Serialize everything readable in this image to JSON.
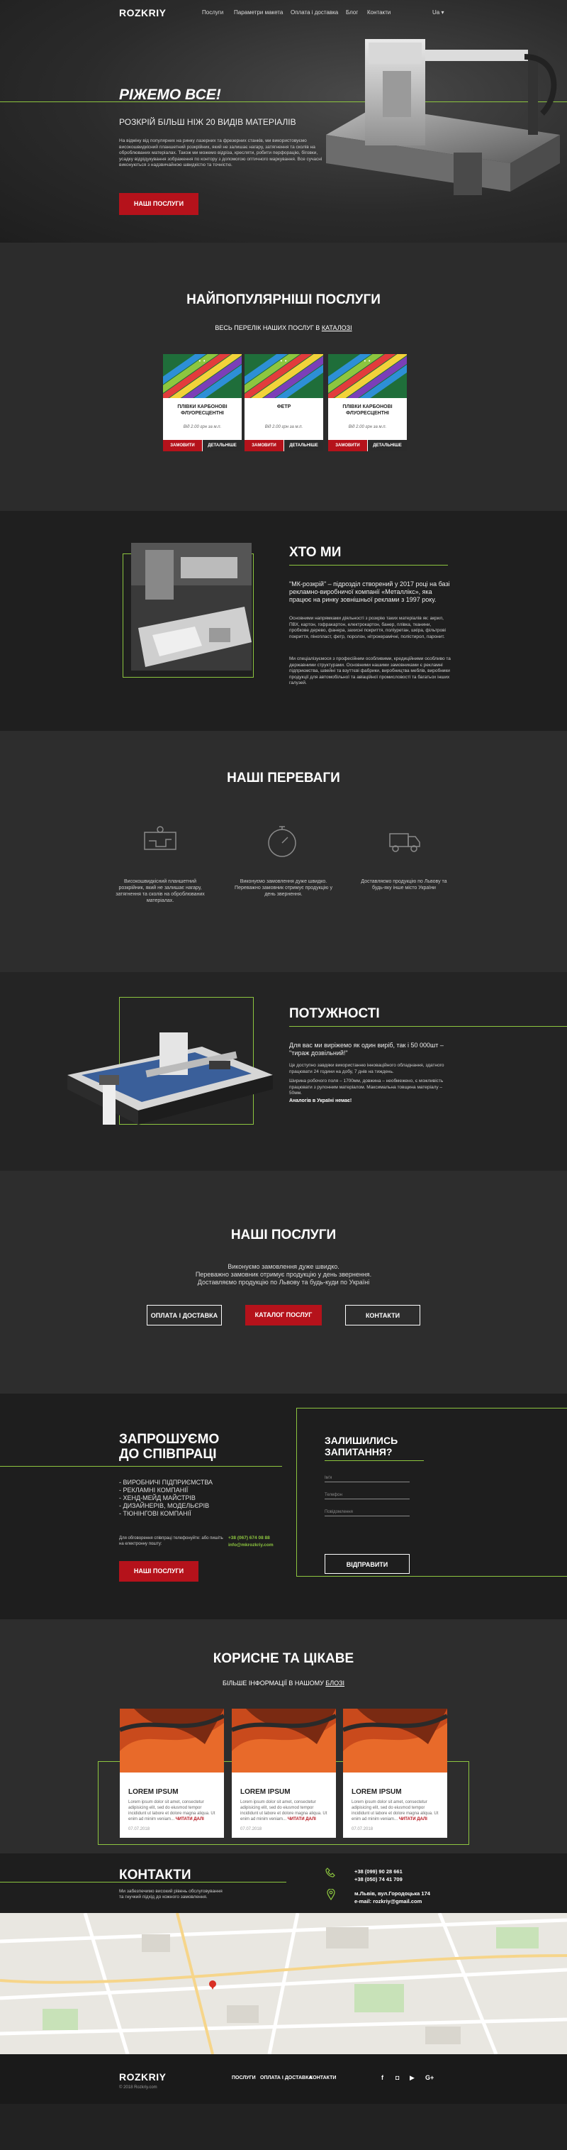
{
  "header": {
    "logo": "ROZKRIY",
    "nav": [
      "Послуги",
      "Параметри макета",
      "Оплата і доставка",
      "Блог",
      "Контакти"
    ],
    "lang": "Ua ▾"
  },
  "hero": {
    "title": "РІЖЕМО ВСЕ!",
    "subtitle": "РОЗКРІЙ БІЛЬШ НІЖ 20 ВИДІВ МАТЕРІАЛІВ",
    "text": "На відміну від популярних на ринку лазерних та фрезерних станків, ми використовуємо високошвидкісний планшетний розкрійник, який не залишає нагару, затягнення та сколів на оброблюваних матеріалах. Також ми можемо відріза, кресляти, робити перфорацію, біговки, усадку відрідукування зображення по контору з допомогою оптичного маркування. Все сучасні виконуються з надзвичайною швидкістю та точністю.",
    "button": "НАШІ ПОСЛУГИ"
  },
  "services": {
    "title": "НАЙПОПУЛЯРНІШІ ПОСЛУГИ",
    "subtitle_pre": "ВЕСЬ ПЕРЕЛІК НАШИХ ПОСЛУГ В ",
    "subtitle_link": "КАТАЛОЗІ",
    "cards": [
      {
        "title": "ПЛІВКИ КАРБОНОВІ ФЛУОРЕСЦЕНТНІ",
        "price": "Від 2.00 грн за м.п.",
        "order": "ЗАМОВИТИ",
        "details": "ДЕТАЛЬНІШЕ"
      },
      {
        "title": "ФЕТР",
        "price": "Від 2.00 грн за м.п.",
        "order": "ЗАМОВИТИ",
        "details": "ДЕТАЛЬНІШЕ"
      },
      {
        "title": "ПЛІВКИ КАРБОНОВІ ФЛУОРЕСЦЕНТНІ",
        "price": "Від 2.00 грн за м.п.",
        "order": "ЗАМОВИТИ",
        "details": "ДЕТАЛЬНІШЕ"
      }
    ]
  },
  "about": {
    "title": "ХТО МИ",
    "lead": "\"МК-розкрій\" – підрозділ створений у 2017 році на базі рекламно-виробничої компанії «Металлікс», яка працює на ринку зовнішньої реклами з 1997 року.",
    "p1": "Основними напрямками діяльності з розкрію таких матеріалів як: акрил, ПВХ, картон, гофракартон, електрокартон, банер, плівка, тканини, пробкове дерево, фанера, захисні покриття, поліуретан, шкіра, фільтрові покриття, пінопласт, фетр, поролон, нітрокерамічні, полістирол, паронит.",
    "p2": "Ми спеціалізуємося з професійним особливими, кредиційними особливо та державними структурами. Основними нашими замовниками є рекламні підприємства, швейні та взуттєві фабрики, виробництва меблів, виробники продукції для автомобільної та авіаційної промисловості та багатьох інших галузей."
  },
  "advantages": {
    "title": "НАШІ ПЕРЕВАГИ",
    "items": [
      {
        "icon": "plotter-icon",
        "text": "Високошвидкісний планшетний розкрійник, який не залишає нагару, затягнення та сколів на оброблюваних матеріалах."
      },
      {
        "icon": "stopwatch-icon",
        "text": "Виконуємо замовлення дуже швидко. Переважно замовник отримує продукцію у день звернення."
      },
      {
        "icon": "truck-icon",
        "text": "Доставляємо продукцію по Львову та будь-яку інше місто України"
      }
    ]
  },
  "power": {
    "title": "ПОТУЖНОСТІ",
    "lead": "Для вас ми виріжемо як один виріб, так і 50 000шт – \"тираж дозвільний!\"",
    "p1": "Це доступно завдяки використанню інноваційного обладнання, здатного працювати 24 години на добу, 7 днів на тиждень.",
    "p2": "Ширина робочого поля – 1700мм, довжина – необмежено, є можливість працювати з рулонним матеріалом. Максимальна товщина матеріалу – 50мм.",
    "p3": "Аналогів в Україні немає!"
  },
  "ours": {
    "title": "НАШІ ПОСЛУГИ",
    "lines": [
      "Виконуємо замовлення дуже швидко.",
      "Переважно замовник отримує продукцію у день звернення.",
      "Доставляємо продукцію по Львову та будь-куди по Україні"
    ],
    "buttons": [
      "ОПЛАТА І ДОСТАВКА",
      "КАТАЛОГ ПОСЛУГ",
      "КОНТАКТИ"
    ]
  },
  "coop": {
    "title1": "ЗАПРОШУЄМО",
    "title2": "ДО СПІВПРАЦІ",
    "list": [
      "- ВИРОБНИЧІ ПІДПРИЄМСТВА",
      "- РЕКЛАМНІ КОМПАНІЇ",
      "- ХЕНД-МЕЙД МАЙСТРІВ",
      "- ДИЗАЙНЕРІВ, МОДЕЛЬЄРІВ",
      "- ТЮНІНГОВІ КОМПАНІЇ"
    ],
    "contact_text": "Для обговорення співпраці телефонуйте: або пишіть на електронну пошту:",
    "phone": "+38 (067) 674 08 88",
    "email": "info@mkrozkriy.com",
    "button": "НАШІ ПОСЛУГИ",
    "form_title1": "ЗАЛИШИЛИСЬ",
    "form_title2": "ЗАПИТАННЯ?",
    "f_name": "Ім'я",
    "f_phone": "Телефон",
    "f_msg": "Повідомлення",
    "f_button": "ВІДПРАВИТИ"
  },
  "blog": {
    "title": "КОРИСНЕ ТА ЦІКАВЕ",
    "subtitle_pre": "БІЛЬШЕ ІНФОРМАЦІЇ В НАШОМУ ",
    "subtitle_link": "БЛОЗІ",
    "posts": [
      {
        "title": "LOREM IPSUM",
        "text": "Lorem ipsum dolor sit amet, consectetur adipisicing elit, sed do eiusmod tempor incididunt ut labore et dolore magna aliqua. Ut enim ad minim veniam...",
        "more": "ЧИТАТИ ДАЛІ",
        "date": "07.07.2018"
      },
      {
        "title": "LOREM IPSUM",
        "text": "Lorem ipsum dolor sit amet, consectetur adipisicing elit, sed do eiusmod tempor incididunt ut labore et dolore magna aliqua. Ut enim ad minim veniam...",
        "more": "ЧИТАТИ ДАЛІ",
        "date": "07.07.2018"
      },
      {
        "title": "LOREM IPSUM",
        "text": "Lorem ipsum dolor sit amet, consectetur adipisicing elit, sed do eiusmod tempor incididunt ut labore et dolore magna aliqua. Ut enim ad minim veniam...",
        "more": "ЧИТАТИ ДАЛІ",
        "date": "07.07.2018"
      }
    ]
  },
  "contacts": {
    "title": "КОНТАКТИ",
    "text": "Ми забезпечимо високий рівень обслуговування та гнучкий підхід до кожного замовлення.",
    "phone1": "+38 (099) 90 28 661",
    "phone2": "+38 (050) 74 41 709",
    "address": "м.Львів, вул.Городоцька 174",
    "email": "e-mail: rozkriy@gmail.com"
  },
  "footer": {
    "logo": "ROZKRIY",
    "copy": "© 2018 Rozkriy.com",
    "nav": [
      "ПОСЛУГИ",
      "ОПЛАТА І ДОСТАВКА",
      "КОНТАКТИ"
    ],
    "social": [
      "f",
      "◘",
      "▶",
      "G+"
    ]
  },
  "colors": {
    "accent": "#8dc63f",
    "button": "#b5121b"
  }
}
